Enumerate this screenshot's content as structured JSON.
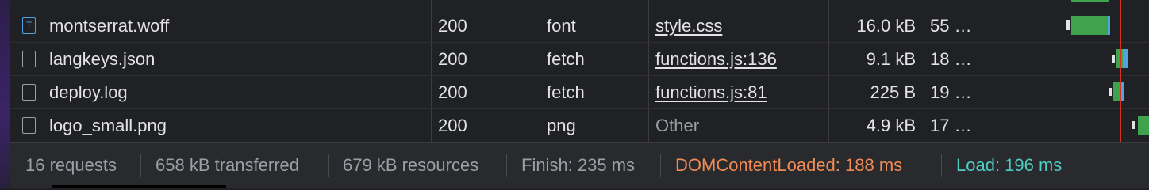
{
  "rows": [
    {
      "name": "montserrat.woff",
      "status": "200",
      "type": "font",
      "initiator": "style.css",
      "initiator_is_link": true,
      "size": "16.0 kB",
      "time": "55 …",
      "icon": "font-file-icon"
    },
    {
      "name": "langkeys.json",
      "status": "200",
      "type": "fetch",
      "initiator": "functions.js:136",
      "initiator_is_link": true,
      "size": "9.1 kB",
      "time": "18 …",
      "icon": "document-icon"
    },
    {
      "name": "deploy.log",
      "status": "200",
      "type": "fetch",
      "initiator": "functions.js:81",
      "initiator_is_link": true,
      "size": "225 B",
      "time": "19 …",
      "icon": "document-icon"
    },
    {
      "name": "logo_small.png",
      "status": "200",
      "type": "png",
      "initiator": "Other",
      "initiator_is_link": false,
      "size": "4.9 kB",
      "time": "17 …",
      "icon": "document-icon"
    }
  ],
  "footer": {
    "requests": "16 requests",
    "transferred": "658 kB transferred",
    "resources": "679 kB resources",
    "finish": "Finish: 235 ms",
    "dom_content_loaded": "DOMContentLoaded: 188 ms",
    "load": "Load: 196 ms"
  },
  "colors": {
    "dom_content_loaded": "#f28b54",
    "load": "#4ecdc4",
    "waterfall_green": "#3fa34d",
    "waterfall_blue": "#4ea3e0",
    "load_line": "#d93025",
    "dcl_line": "#1a73e8"
  }
}
